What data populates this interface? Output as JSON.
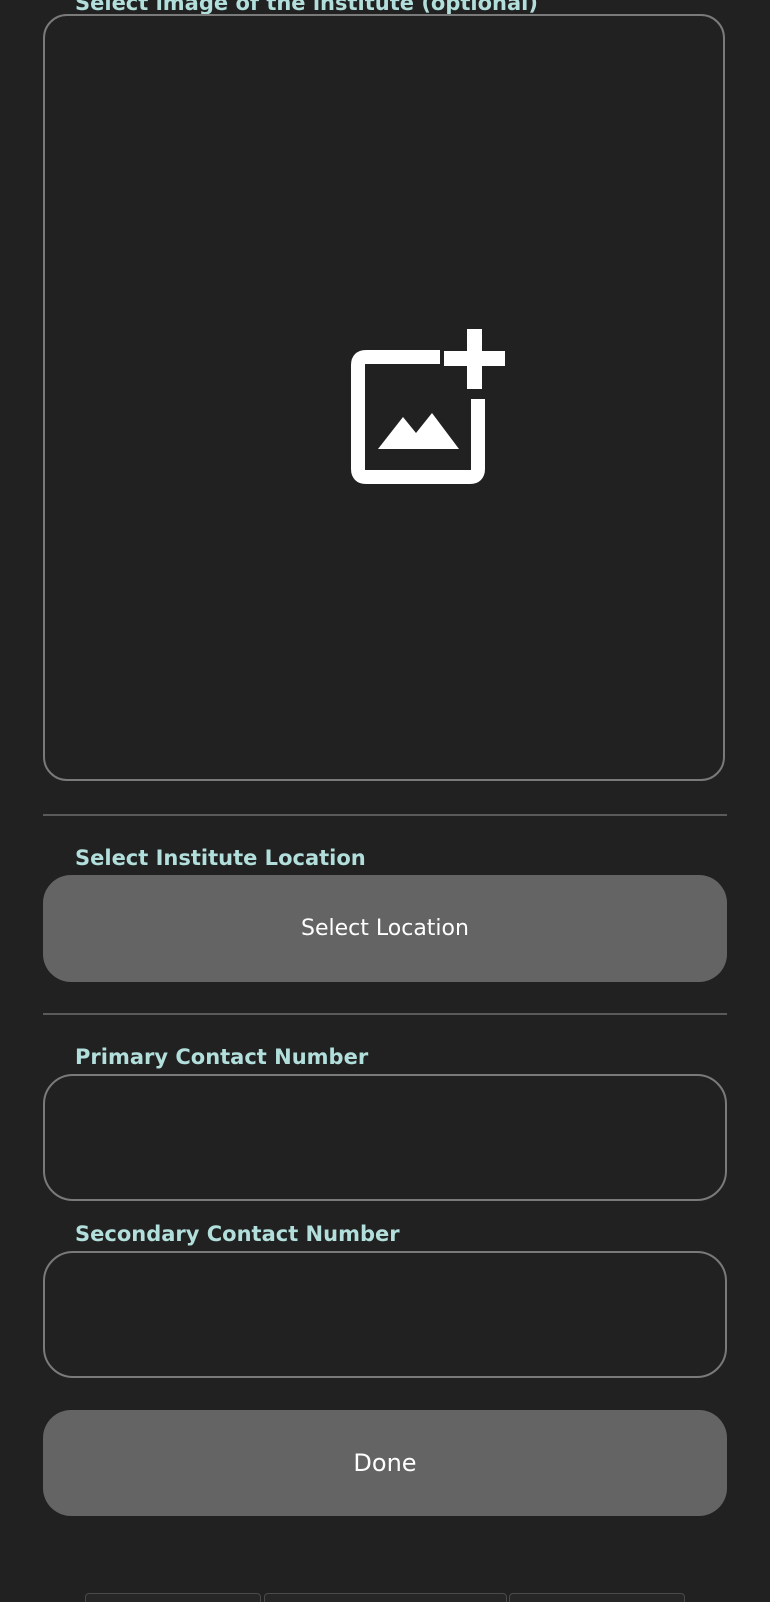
{
  "image_section": {
    "label": "Select image of the institute (optional)",
    "icon": "add-photo-icon"
  },
  "location_section": {
    "label": "Select Institute Location",
    "button_label": "Select Location"
  },
  "primary_contact": {
    "label": "Primary Contact Number",
    "value": "",
    "placeholder": ""
  },
  "secondary_contact": {
    "label": "Secondary Contact Number",
    "value": "",
    "placeholder": ""
  },
  "actions": {
    "done_label": "Done"
  },
  "colors": {
    "background": "#212121",
    "label_accent": "#b2dfdb",
    "button_fill": "#646464",
    "field_border": "#7a7a7a",
    "text": "#ffffff"
  }
}
